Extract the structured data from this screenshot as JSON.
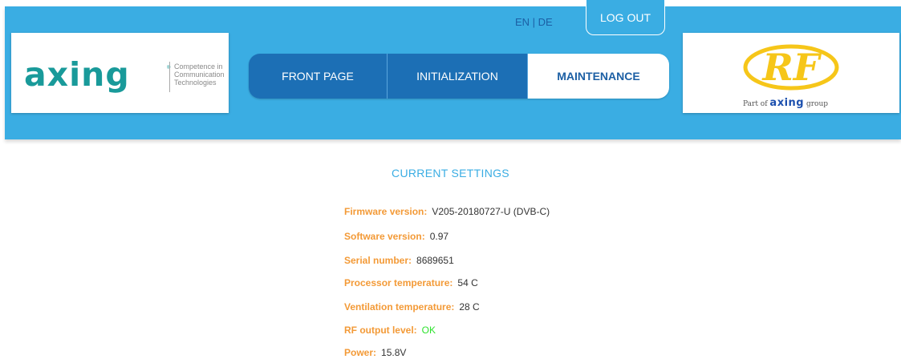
{
  "header": {
    "lang": {
      "en": "EN",
      "sep": " | ",
      "de": "DE"
    },
    "logout_label": "LOG OUT",
    "left_logo": {
      "brand": "axing",
      "reg_mark": "®",
      "tagline_lines": [
        "Competence in",
        "Communication",
        "Technologies"
      ]
    },
    "right_logo": {
      "mark": "RF",
      "part_of": "Part of",
      "brand": "axing",
      "group": "group",
      "colors": {
        "mark": "#f6c619",
        "brand": "#1b4fae"
      }
    },
    "colors": {
      "bar": "#3aade3",
      "tab": "#1c6fb5",
      "tab_active_text": "#1c5fa4"
    }
  },
  "nav": {
    "tabs": [
      {
        "label": "FRONT PAGE",
        "active": false
      },
      {
        "label": "INITIALIZATION",
        "active": false
      },
      {
        "label": "MAINTENANCE",
        "active": true
      }
    ]
  },
  "current_settings": {
    "title": "CURRENT SETTINGS",
    "rows": [
      {
        "label": "Firmware version:",
        "value": "V205-20180727-U (DVB-C)"
      },
      {
        "label": "Software version:",
        "value": "0.97"
      },
      {
        "label": "Serial number:",
        "value": "8689651"
      },
      {
        "label": "Processor temperature:",
        "value": "54 C"
      },
      {
        "label": "Ventilation temperature:",
        "value": "28 C"
      },
      {
        "label": "RF output level:",
        "value": "OK"
      },
      {
        "label": "Power:",
        "value": "15.8V"
      }
    ],
    "colors": {
      "label": "#f39a37",
      "ok": "#2ee22e"
    }
  }
}
